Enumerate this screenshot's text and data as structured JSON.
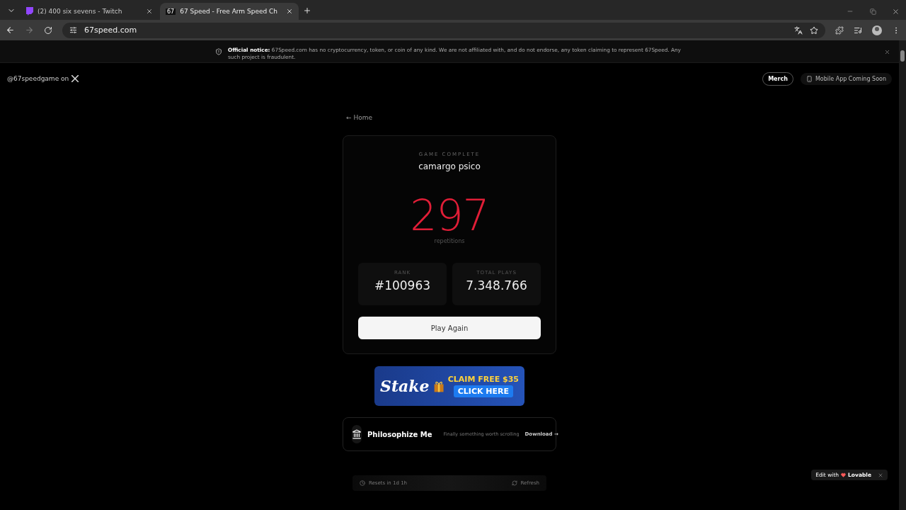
{
  "browser": {
    "tabs": [
      {
        "title": "(2) 400 six sevens - Twitch",
        "selected": false
      },
      {
        "title": "67 Speed - Free Arm Speed Ch",
        "favicon_text": "67",
        "selected": true
      }
    ],
    "url": "67speed.com"
  },
  "notice": {
    "label": "Official notice:",
    "text": "67Speed.com has no cryptocurrency, token, or coin of any kind. We are not affiliated with, and do not endorse, any token claiming to represent 67Speed. Any such project is fraudulent."
  },
  "header": {
    "social": "@67speedgame on",
    "merch": "Merch",
    "mobile": "Mobile App Coming Soon"
  },
  "back_link": "← Home",
  "result": {
    "eyebrow": "GAME COMPLETE",
    "player": "camargo psico",
    "score": "297",
    "score_label": "repetitions",
    "stats": [
      {
        "label": "RANK",
        "value": "#100963"
      },
      {
        "label": "TOTAL PLAYS",
        "value": "7.348.766"
      }
    ],
    "button": "Play Again"
  },
  "ad": {
    "brand": "Stake",
    "headline": "CLAIM FREE $35",
    "cta": "CLICK HERE"
  },
  "promo": {
    "name": "Philosophize Me",
    "tagline": "Finally something worth scrolling",
    "action": "Download →"
  },
  "footer_strip": {
    "resets": "Resets in 1d 1h",
    "refresh": "Refresh"
  },
  "edit_badge": {
    "label": "Edit with",
    "brand": "Lovable"
  }
}
